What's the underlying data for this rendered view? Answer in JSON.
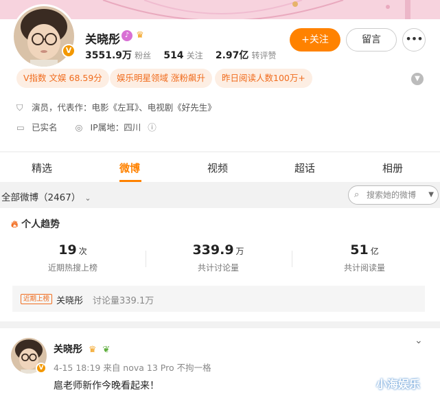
{
  "profile": {
    "name": "关晓彤",
    "verified_badge": "V",
    "followers_value": "3551.9万",
    "followers_label": "粉丝",
    "following_value": "514",
    "following_label": "关注",
    "reposts_value": "2.97亿",
    "reposts_label": "转评赞",
    "follow_label": "+关注",
    "message_label": "留言",
    "more_label": "•••"
  },
  "tags": [
    "V指数 文娱 68.59分",
    "娱乐明星领域 涨粉飙升",
    "昨日阅读人数100万+"
  ],
  "info": {
    "occupation": "演员，代表作：电影《左耳》、电视剧《好先生》",
    "real_name": "已实名",
    "ip_location": "IP属地：四川"
  },
  "tabs": [
    "精选",
    "微博",
    "视频",
    "超话",
    "相册"
  ],
  "active_tab": "微博",
  "filter": {
    "label": "全部微博（2467）",
    "search_placeholder": "搜索她的微博"
  },
  "trend": {
    "title": "个人趋势",
    "stats": [
      {
        "value": "19",
        "unit": "次",
        "label": "近期热搜上榜"
      },
      {
        "value": "339.9",
        "unit": "万",
        "label": "共计讨论量"
      },
      {
        "value": "51",
        "unit": "亿",
        "label": "共计阅读量"
      }
    ],
    "hot_badge": "近期上榜",
    "hot_name": "关晓彤",
    "hot_count": "讨论量339.1万"
  },
  "post": {
    "name": "关晓彤",
    "meta": "4-15 18:19  来自 nova 13 Pro 不拘一格",
    "text": "扈老师新作今晚看起来！"
  },
  "watermark": "小海娱乐",
  "colors": {
    "accent": "#ff8200",
    "tag_bg": "#fdeee3",
    "tag_text": "#f06b1c"
  },
  "icons": [
    "shield-icon",
    "id-card-icon",
    "location-icon",
    "help-icon",
    "fire-icon",
    "search-icon",
    "chevron-down-icon",
    "more-icon",
    "crown-icon",
    "sprout-icon"
  ]
}
